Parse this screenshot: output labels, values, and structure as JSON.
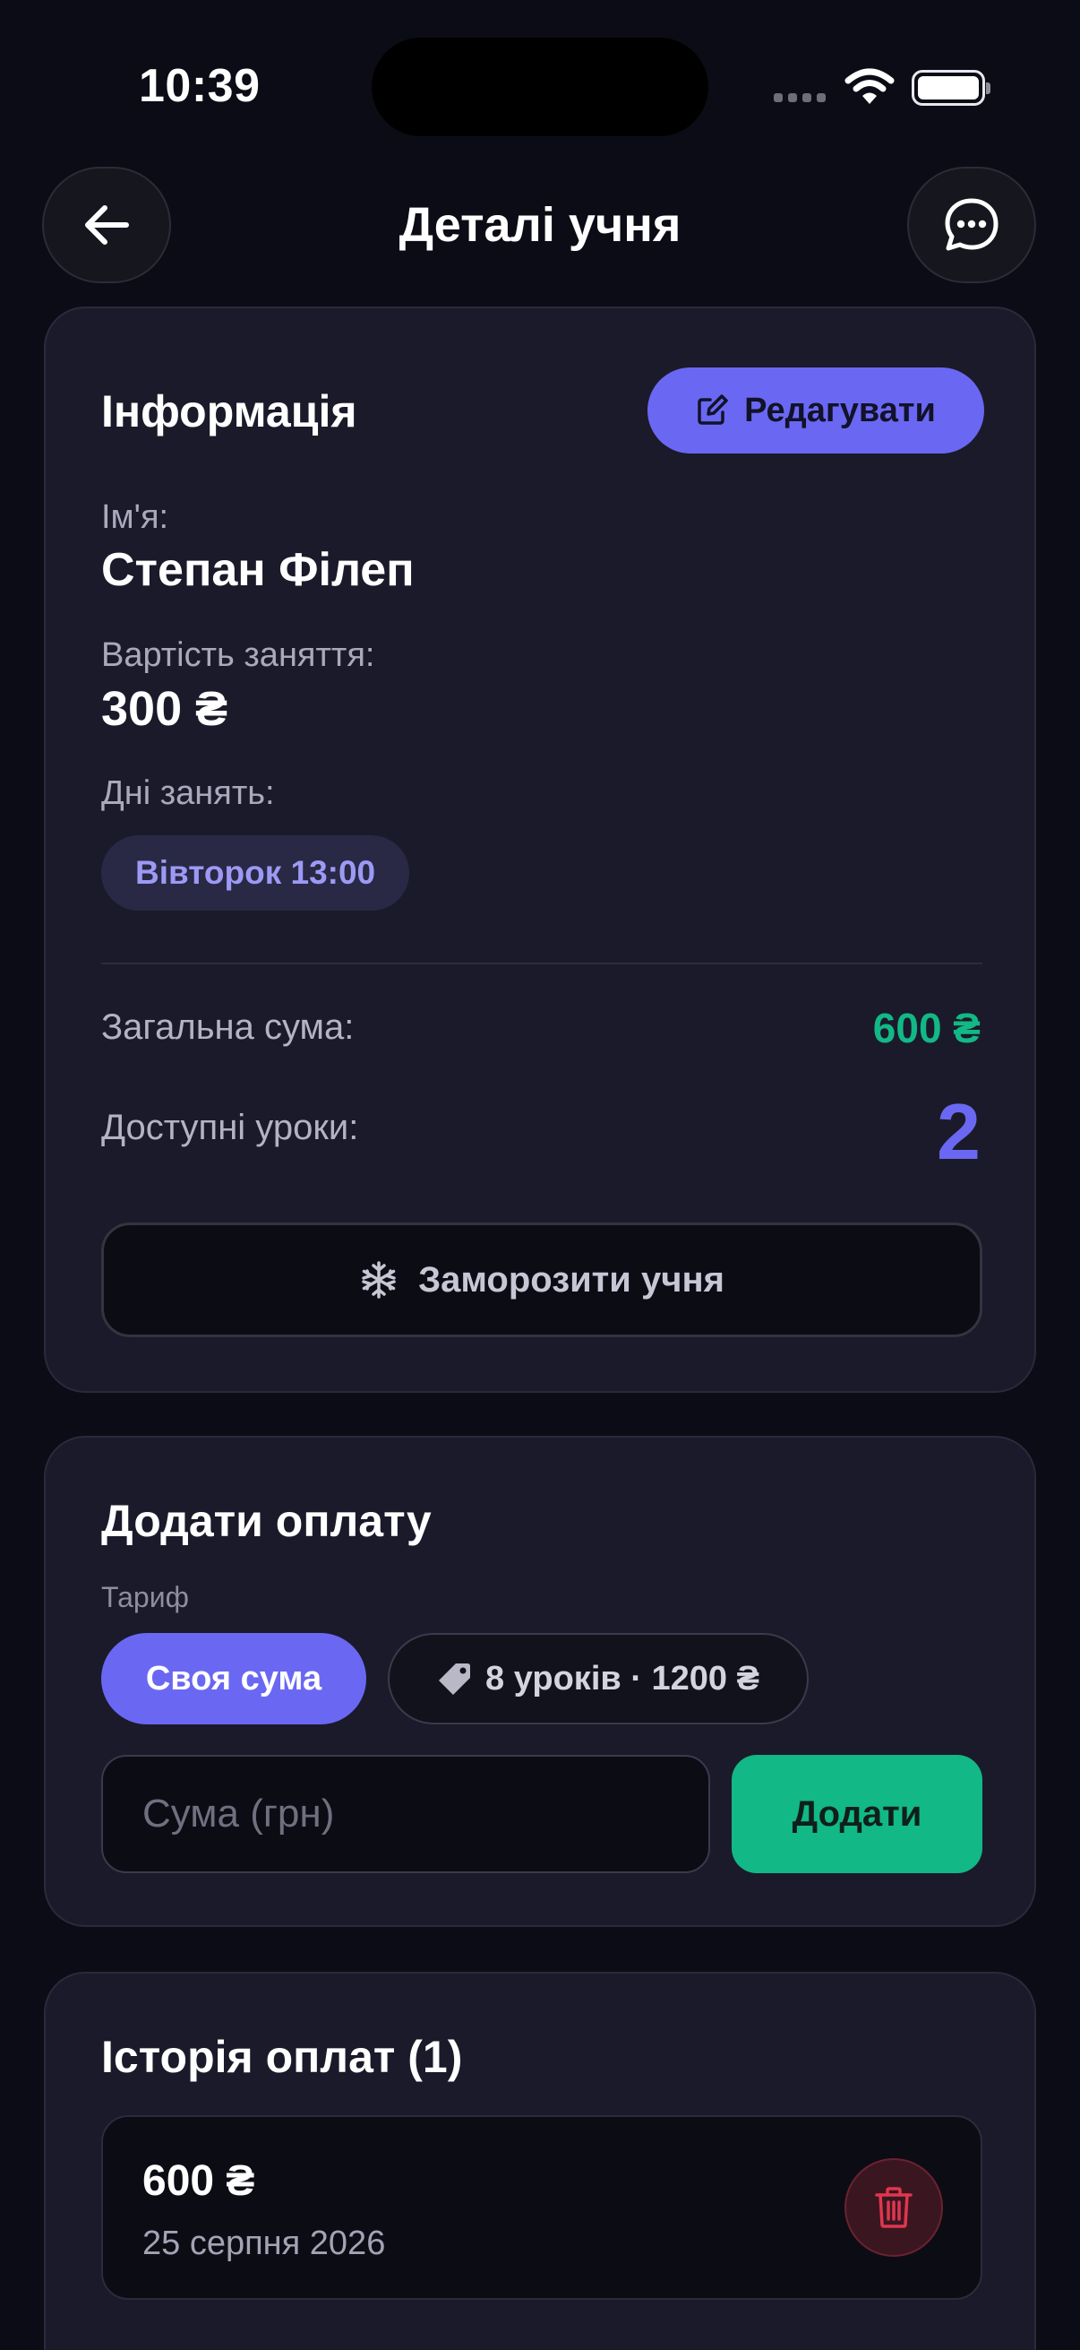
{
  "status_bar": {
    "time": "10:39"
  },
  "header": {
    "title": "Деталі учня"
  },
  "info": {
    "title": "Інформація",
    "edit_label": "Редагувати",
    "name_label": "Ім'я:",
    "name_value": "Степан Філеп",
    "price_label": "Вартість заняття:",
    "price_value": "300 ₴",
    "days_label": "Дні занять:",
    "days": [
      "Вівторок 13:00"
    ],
    "total_label": "Загальна сума:",
    "total_value": "600 ₴",
    "lessons_label": "Доступні уроки:",
    "lessons_value": "2",
    "freeze_label": "Заморозити учня"
  },
  "payment": {
    "title": "Додати оплату",
    "tariff_label": "Тариф",
    "tariffs": [
      {
        "label": "Своя сума",
        "selected": true
      },
      {
        "label": "8 уроків · 1200 ₴",
        "selected": false
      }
    ],
    "amount_placeholder": "Сума (грн)",
    "amount_value": "",
    "add_label": "Додати"
  },
  "history": {
    "title": "Історія оплат (1)",
    "items": [
      {
        "amount": "600 ₴",
        "date": "25 серпня 2026"
      }
    ]
  },
  "colors": {
    "accent": "#6a68f2",
    "success": "#12b886",
    "danger": "#e0364f",
    "card": "#1b1a2a",
    "background": "#0c0c16"
  }
}
